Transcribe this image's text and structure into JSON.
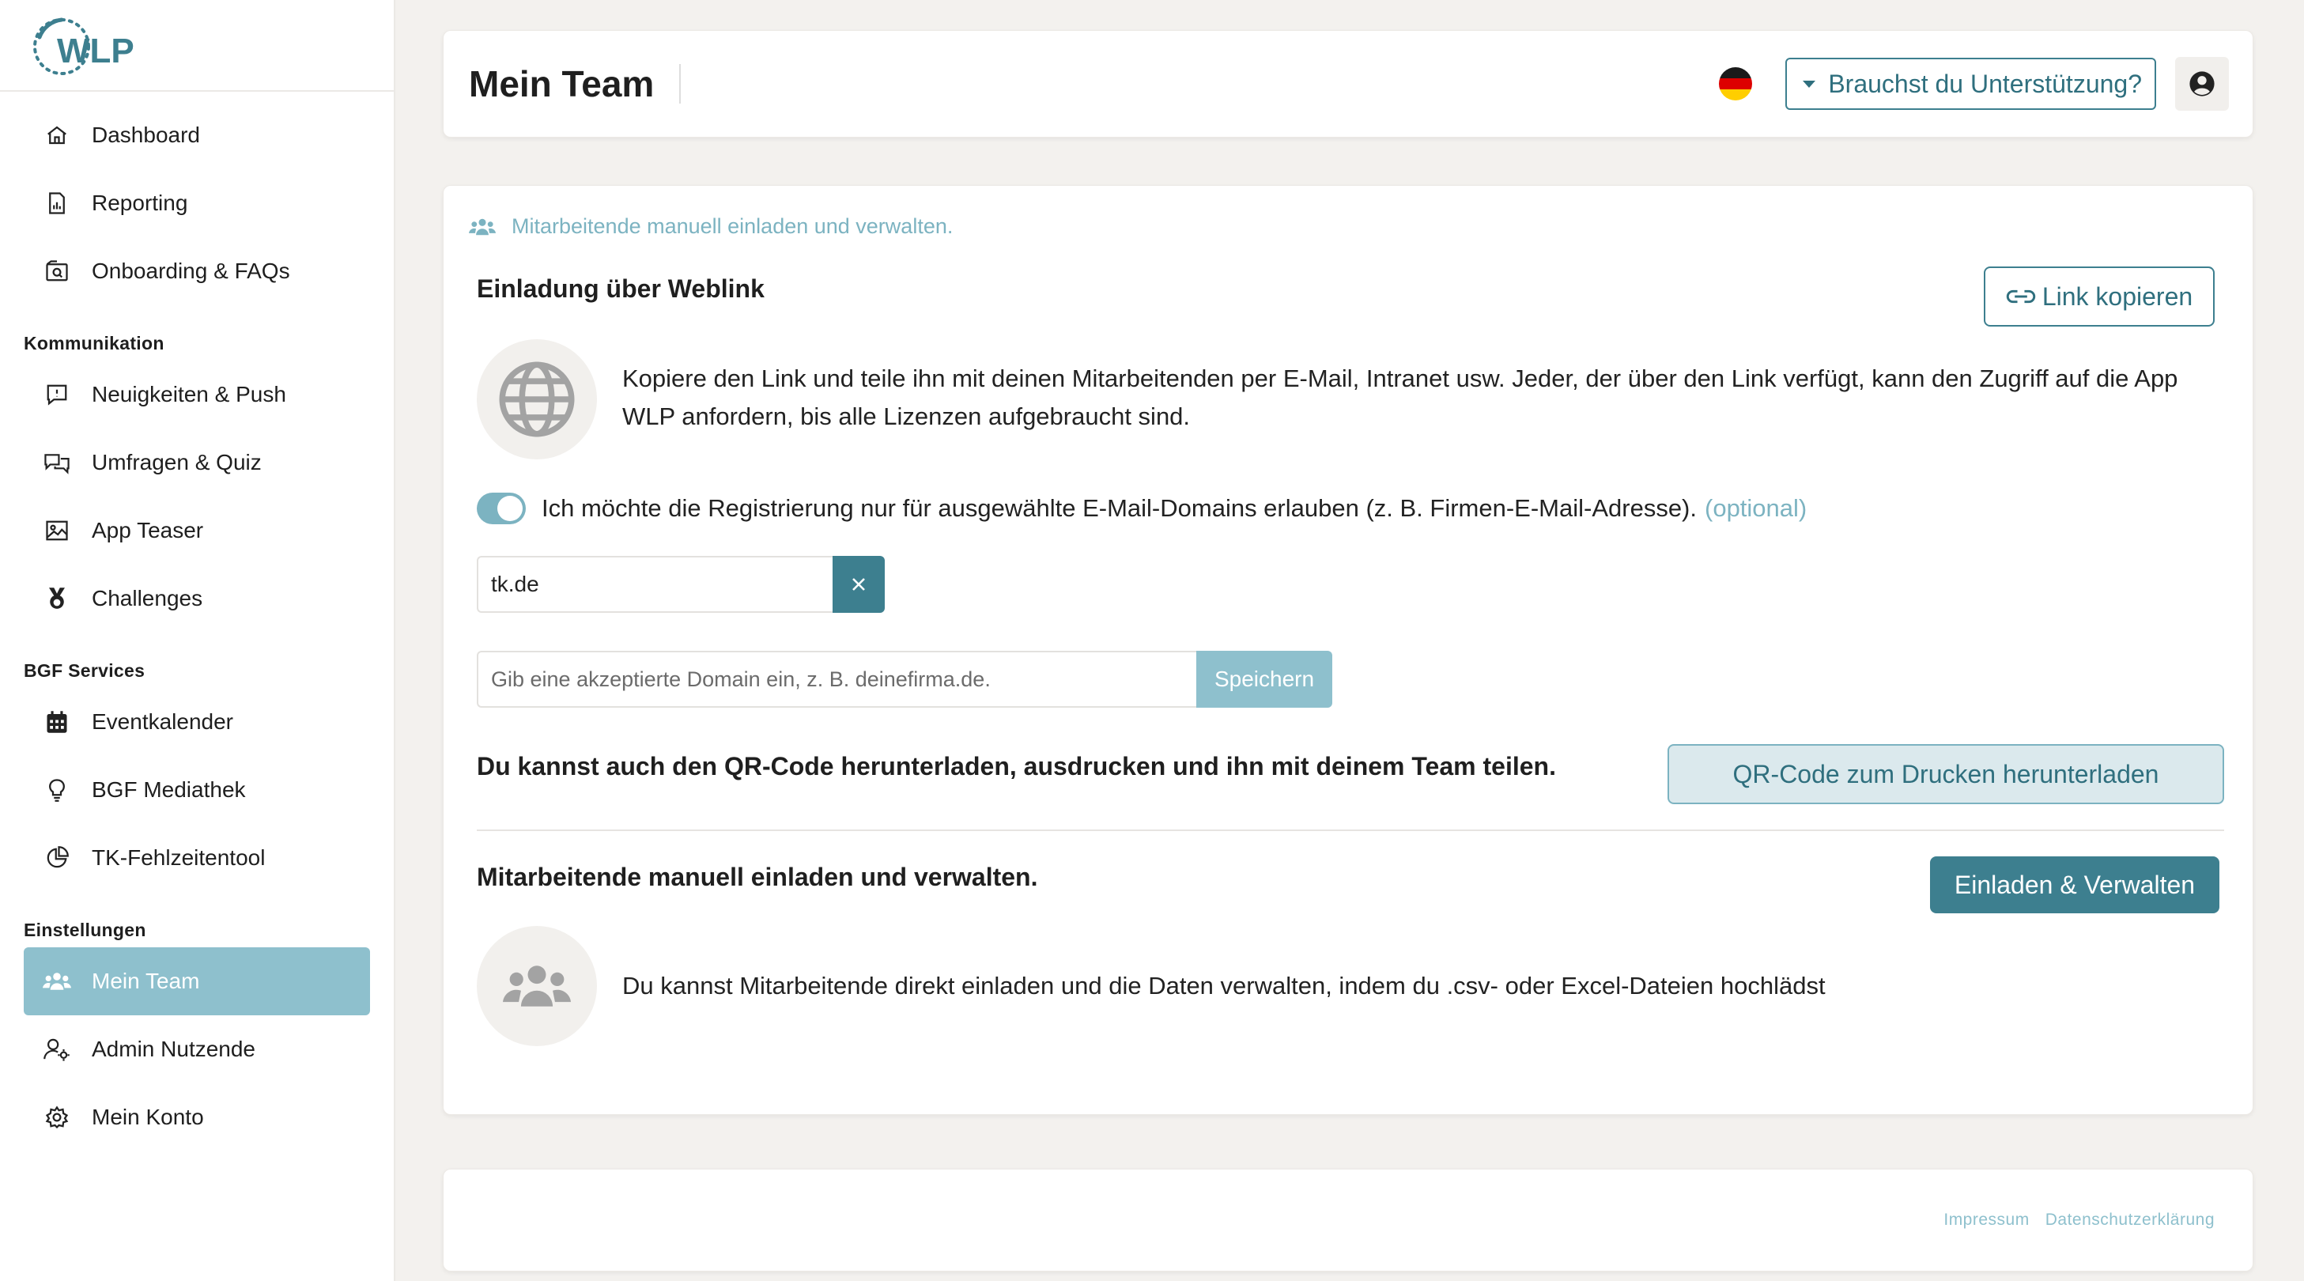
{
  "app": {
    "logo_text": "WLP"
  },
  "sidebar": {
    "items_top": [
      {
        "label": "Dashboard",
        "icon": "home-icon"
      },
      {
        "label": "Reporting",
        "icon": "report-file-icon"
      },
      {
        "label": "Onboarding & FAQs",
        "icon": "onboarding-icon"
      }
    ],
    "section_kommunikation": "Kommunikation",
    "items_kommunikation": [
      {
        "label": "Neuigkeiten & Push",
        "icon": "news-icon"
      },
      {
        "label": "Umfragen & Quiz",
        "icon": "chat-icon"
      },
      {
        "label": "App Teaser",
        "icon": "image-icon"
      },
      {
        "label": "Challenges",
        "icon": "medal-icon"
      }
    ],
    "section_bgf": "BGF Services",
    "items_bgf": [
      {
        "label": "Eventkalender",
        "icon": "calendar-icon"
      },
      {
        "label": "BGF Mediathek",
        "icon": "lightbulb-icon"
      },
      {
        "label": "TK-Fehlzeitentool",
        "icon": "pie-chart-icon"
      }
    ],
    "section_einstellungen": "Einstellungen",
    "items_einstellungen": [
      {
        "label": "Mein Team",
        "icon": "team-icon",
        "active": true
      },
      {
        "label": "Admin Nutzende",
        "icon": "user-settings-icon"
      },
      {
        "label": "Mein Konto",
        "icon": "gear-icon"
      }
    ]
  },
  "header": {
    "title": "Mein Team",
    "language_flag": "germany-flag-icon",
    "support_label": "Brauchst du Unterstützung?",
    "user_icon": "user-circle-icon"
  },
  "main": {
    "breadcrumb": "Mitarbeitende manuell einladen und verwalten.",
    "weblink": {
      "title": "Einladung über Weblink",
      "copy_button": "Link kopieren",
      "description": "Kopiere den Link und teile ihn mit deinen Mitarbeitenden per E-Mail, Intranet usw. Jeder, der über den Link verfügt, kann den Zugriff auf die App WLP anfordern, bis alle Lizenzen aufgebraucht sind.",
      "toggle_label": "Ich möchte die Registrierung nur für ausgewählte E-Mail-Domains erlauben (z. B. Firmen-E-Mail-Adresse).",
      "toggle_optional": "(optional)",
      "toggle_on": true,
      "domain_value": "tk.de",
      "domain_placeholder": "Gib eine akzeptierte Domain ein, z. B. deinefirma.de.",
      "save_button": "Speichern"
    },
    "qr": {
      "text": "Du kannst auch den QR-Code herunterladen, ausdrucken und ihn mit deinem Team teilen.",
      "button": "QR-Code zum Drucken herunterladen"
    },
    "manual": {
      "title": "Mitarbeitende manuell einladen und verwalten.",
      "button": "Einladen & Verwalten",
      "description": "Du kannst Mitarbeitende direkt einladen und die Daten verwalten, indem du .csv- oder Excel-Dateien hochlädst"
    }
  },
  "footer": {
    "impressum": "Impressum",
    "datenschutz": "Datenschutzerklärung"
  },
  "colors": {
    "accent": "#3d7f8f",
    "accent_light": "#8ec0cd",
    "background": "#f3f1ee"
  }
}
